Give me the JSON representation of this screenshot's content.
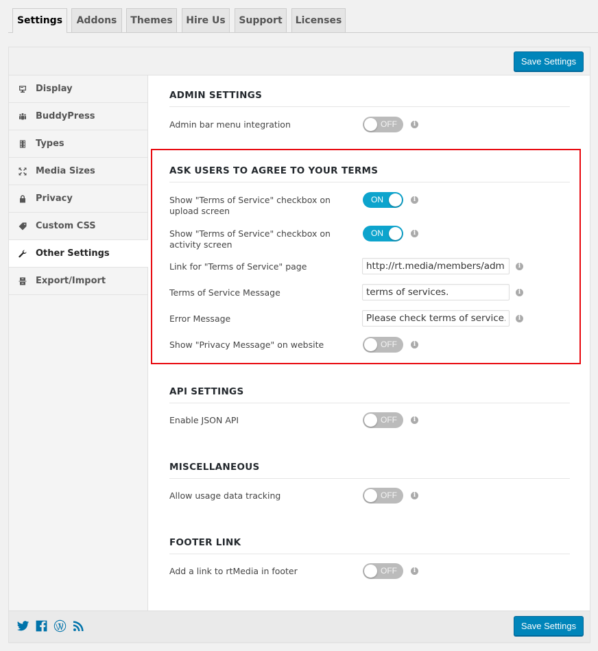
{
  "tabs": [
    {
      "label": "Settings",
      "active": true
    },
    {
      "label": "Addons",
      "active": false
    },
    {
      "label": "Themes",
      "active": false
    },
    {
      "label": "Hire Us",
      "active": false
    },
    {
      "label": "Support",
      "active": false
    },
    {
      "label": "Licenses",
      "active": false
    }
  ],
  "header": {
    "save_label": "Save Settings"
  },
  "sidebar": {
    "items": [
      {
        "label": "Display",
        "icon": "monitor-icon"
      },
      {
        "label": "BuddyPress",
        "icon": "buddypress-icon"
      },
      {
        "label": "Types",
        "icon": "film-icon"
      },
      {
        "label": "Media Sizes",
        "icon": "resize-icon"
      },
      {
        "label": "Privacy",
        "icon": "lock-icon"
      },
      {
        "label": "Custom CSS",
        "icon": "tag-icon"
      },
      {
        "label": "Other Settings",
        "icon": "wrench-icon",
        "active": true
      },
      {
        "label": "Export/Import",
        "icon": "export-import-icon"
      }
    ]
  },
  "sections": {
    "admin": {
      "title": "ADMIN SETTINGS",
      "rows": [
        {
          "label": "Admin bar menu integration",
          "toggle": "OFF"
        }
      ]
    },
    "terms": {
      "title": "ASK USERS TO AGREE TO YOUR TERMS",
      "rows": [
        {
          "label": "Show \"Terms of Service\" checkbox on upload screen",
          "toggle": "ON"
        },
        {
          "label": "Show \"Terms of Service\" checkbox on activity screen",
          "toggle": "ON"
        },
        {
          "label": "Link for \"Terms of Service\" page",
          "value": "http://rt.media/members/admin"
        },
        {
          "label": "Terms of Service Message",
          "value": "terms of services."
        },
        {
          "label": "Error Message",
          "value": "Please check terms of service."
        },
        {
          "label": "Show \"Privacy Message\" on website",
          "toggle": "OFF"
        }
      ]
    },
    "api": {
      "title": "API SETTINGS",
      "rows": [
        {
          "label": "Enable JSON API",
          "toggle": "OFF"
        }
      ]
    },
    "misc": {
      "title": "MISCELLANEOUS",
      "rows": [
        {
          "label": "Allow usage data tracking",
          "toggle": "OFF"
        }
      ]
    },
    "footer_link": {
      "title": "FOOTER LINK",
      "rows": [
        {
          "label": "Add a link to rtMedia in footer",
          "toggle": "OFF"
        }
      ]
    }
  },
  "info_glyph": "i",
  "footer": {
    "save_label": "Save Settings",
    "social": [
      "twitter-icon",
      "facebook-icon",
      "wordpress-icon",
      "rss-icon"
    ]
  },
  "colors": {
    "accent": "#0085ba",
    "toggle_on": "#0da4cd",
    "toggle_off": "#bbbbbb",
    "highlight": "#e8080e"
  }
}
